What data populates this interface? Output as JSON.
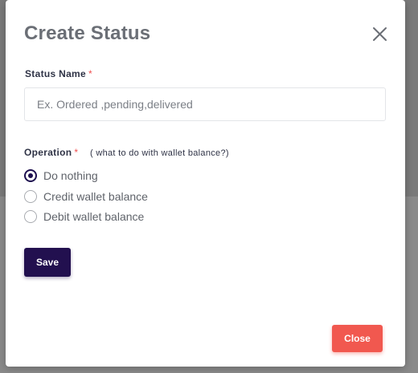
{
  "modal": {
    "title": "Create Status",
    "close_icon": "close-icon"
  },
  "form": {
    "status_name": {
      "label": "Status Name",
      "required_mark": "*",
      "placeholder": "Ex. Ordered ,pending,delivered",
      "value": ""
    },
    "operation": {
      "label": "Operation",
      "required_mark": "*",
      "hint": "( what to do with wallet balance?)",
      "selected": "Do nothing",
      "options": [
        {
          "label": "Do nothing",
          "checked": true
        },
        {
          "label": "Credit wallet balance",
          "checked": false
        },
        {
          "label": "Debit wallet balance",
          "checked": false
        }
      ]
    },
    "save_label": "Save"
  },
  "footer": {
    "close_label": "Close"
  },
  "colors": {
    "primary": "#22104f",
    "danger": "#f1584f",
    "required": "#ef4f4f"
  }
}
